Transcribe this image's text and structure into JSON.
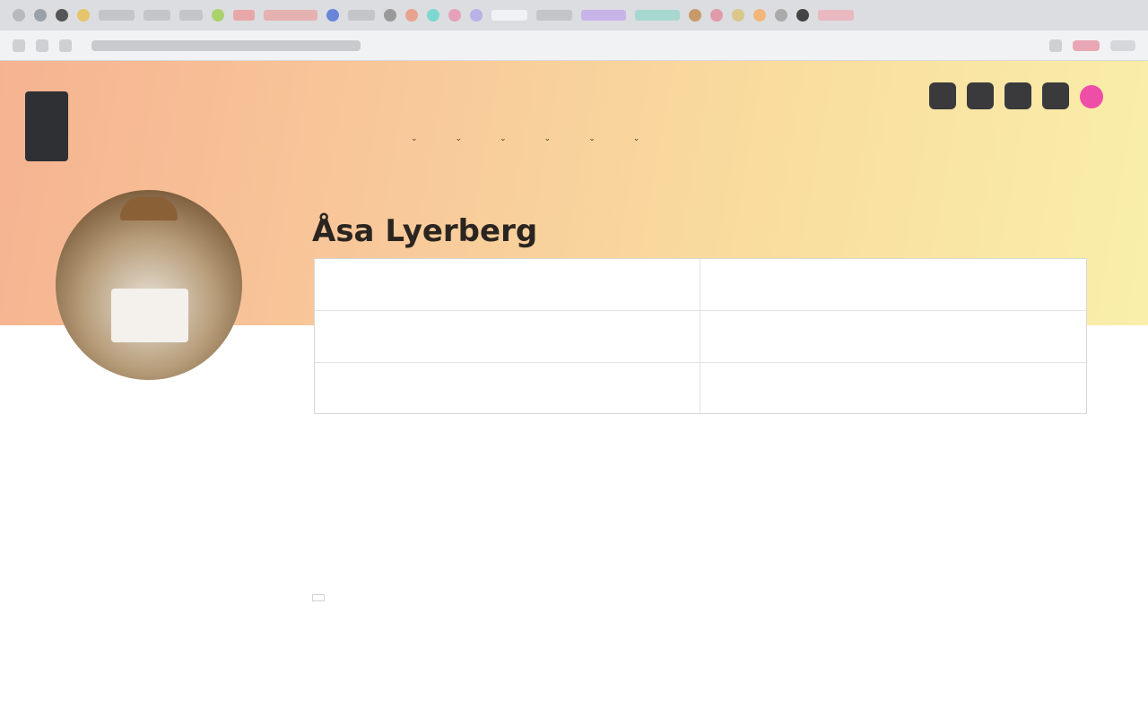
{
  "browser": {
    "tab_count": 28,
    "address_text": ""
  },
  "site": {
    "logo_lines": [
      "",
      ""
    ],
    "utility_links": [
      "",
      "",
      "",
      ""
    ],
    "nav_items": [
      "",
      "",
      "",
      "",
      "",
      ""
    ]
  },
  "profile": {
    "name": "Åsa Lyerberg",
    "info": [
      {
        "label": "",
        "value": ""
      },
      {
        "label": "",
        "value": ""
      },
      {
        "label": "",
        "value": ""
      },
      {
        "label": "",
        "value": ""
      },
      {
        "label": "",
        "value": ""
      },
      {
        "label": "",
        "value": ""
      }
    ],
    "sections": [
      {
        "heading": "",
        "lines": [
          ""
        ]
      },
      {
        "heading": "",
        "lines": [
          "",
          ""
        ]
      },
      {
        "heading": "",
        "badge": ""
      }
    ],
    "paragraph": ""
  },
  "colors": {
    "gradient_start": "#f6b391",
    "gradient_end": "#f9efaa",
    "social_accent": "#ee4da8"
  },
  "icons": [
    "social-icon-1",
    "social-icon-2",
    "social-icon-3",
    "social-icon-4",
    "social-icon-5"
  ]
}
